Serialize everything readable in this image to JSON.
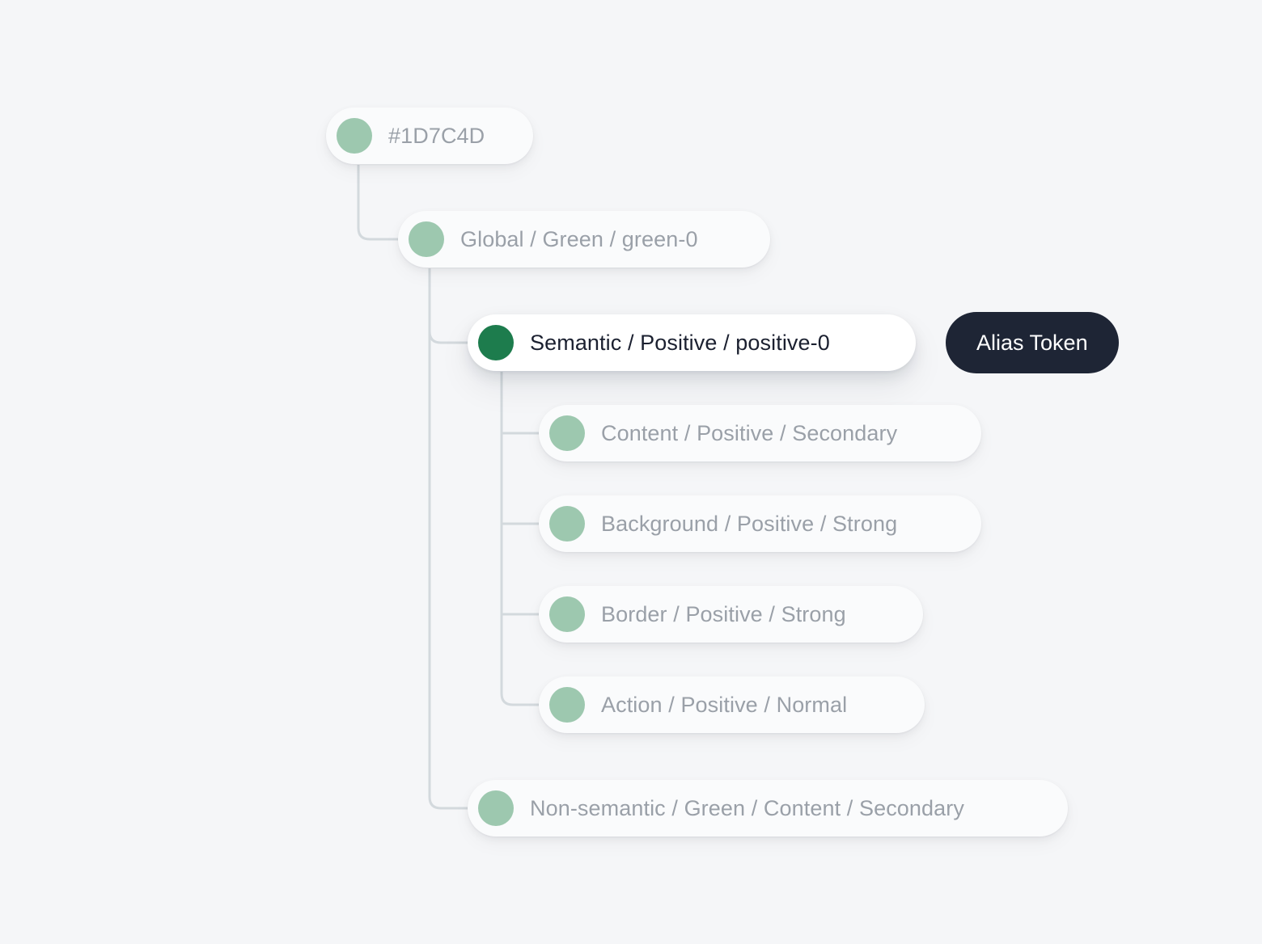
{
  "background_color": "#F5F6F8",
  "palette": {
    "swatch_light": "#9DC8AF",
    "swatch_active": "#1D7C4D",
    "badge_background": "#1E2535",
    "badge_text": "#FFFFFF",
    "node_text": "#9AA0A8",
    "node_text_active": "#1B2030",
    "connector_line": "#D3D9DD"
  },
  "tree": {
    "root": {
      "label": "#1D7C4D",
      "swatch_color": "#9DC8AF",
      "active": false
    },
    "global": {
      "label": "Global / Green / green-0",
      "swatch_color": "#9DC8AF",
      "active": false
    },
    "semantic": {
      "label": "Semantic / Positive / positive-0",
      "swatch_color": "#1D7C4D",
      "active": true
    },
    "semantic_children": [
      {
        "label": "Content / Positive / Secondary",
        "swatch_color": "#9DC8AF",
        "active": false
      },
      {
        "label": "Background / Positive / Strong",
        "swatch_color": "#9DC8AF",
        "active": false
      },
      {
        "label": "Border / Positive / Strong",
        "swatch_color": "#9DC8AF",
        "active": false
      },
      {
        "label": "Action / Positive / Normal",
        "swatch_color": "#9DC8AF",
        "active": false
      }
    ],
    "non_semantic": {
      "label": "Non-semantic / Green / Content / Secondary",
      "swatch_color": "#9DC8AF",
      "active": false
    }
  },
  "badge": {
    "label": "Alias Token"
  }
}
